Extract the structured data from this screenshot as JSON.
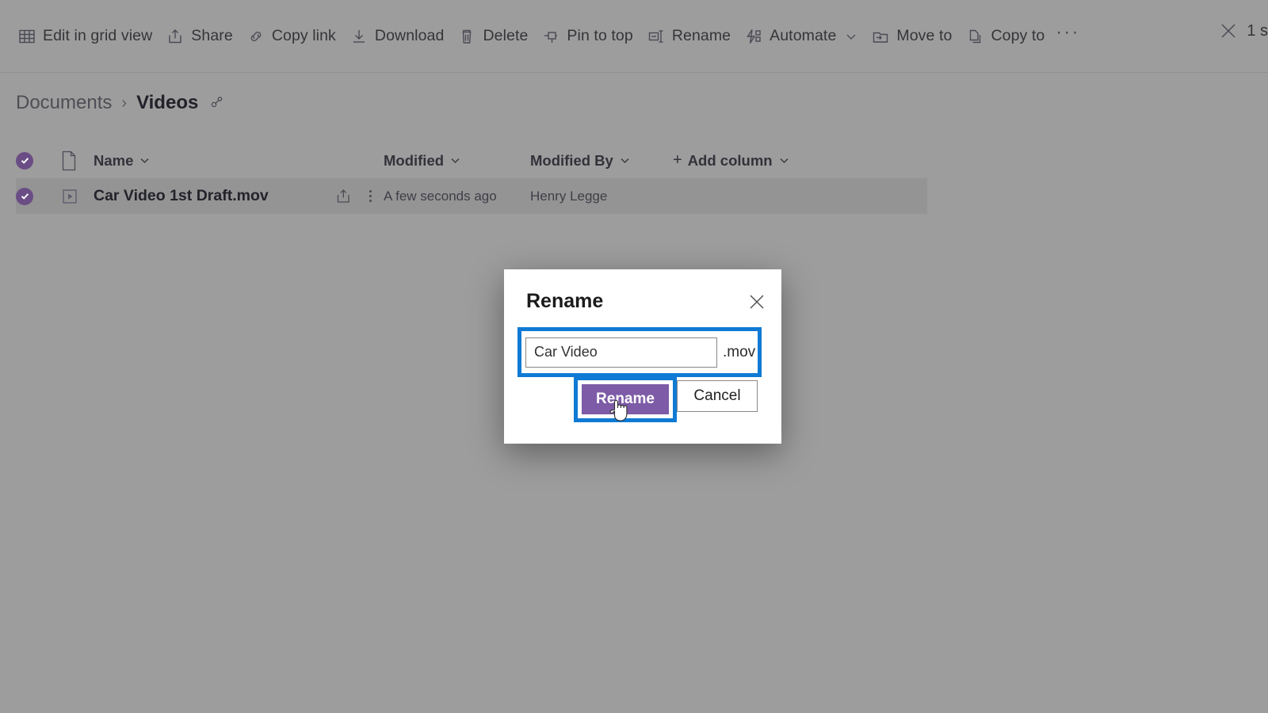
{
  "commandbar": {
    "items": [
      {
        "label": "Edit in grid view",
        "icon": "grid-icon",
        "has_chevron": false
      },
      {
        "label": "Share",
        "icon": "share-icon",
        "has_chevron": false
      },
      {
        "label": "Copy link",
        "icon": "link-icon",
        "has_chevron": false
      },
      {
        "label": "Download",
        "icon": "download-icon",
        "has_chevron": false
      },
      {
        "label": "Delete",
        "icon": "trash-icon",
        "has_chevron": false
      },
      {
        "label": "Pin to top",
        "icon": "pin-icon",
        "has_chevron": false
      },
      {
        "label": "Rename",
        "icon": "rename-icon",
        "has_chevron": false
      },
      {
        "label": "Automate",
        "icon": "automate-icon",
        "has_chevron": true
      },
      {
        "label": "Move to",
        "icon": "move-to-icon",
        "has_chevron": false
      },
      {
        "label": "Copy to",
        "icon": "copy-to-icon",
        "has_chevron": false
      }
    ],
    "overflow_label": "···",
    "selection": {
      "close_icon": "close-icon",
      "text": "1 s"
    }
  },
  "breadcrumb": {
    "root": "Documents",
    "separator": "›",
    "current": "Videos",
    "share_icon": "people-share-icon"
  },
  "list": {
    "columns": {
      "name": "Name",
      "modified": "Modified",
      "modified_by": "Modified By",
      "add_column": "Add column",
      "add_column_plus": "+"
    },
    "rows": [
      {
        "selected": true,
        "type_icon": "video-file-icon",
        "name": "Car Video 1st Draft.mov",
        "modified": "A few seconds ago",
        "modified_by": "Henry Legge",
        "share_icon": "share-icon",
        "more_icon": "more-vertical-icon"
      }
    ]
  },
  "dialog": {
    "title": "Rename",
    "close_icon": "close-icon",
    "input_value": "Car Video",
    "input_placeholder": "Car Video",
    "extension": ".mov",
    "primary_button": "Rename",
    "secondary_button": "Cancel"
  },
  "colors": {
    "accent_purple": "#7d5ba6",
    "selection_purple": "#6b4d85",
    "annotation_blue": "#0f7ad4",
    "overlay_grey": "#9d9d9d",
    "dialog_white": "#ffffff"
  },
  "cursor": {
    "type": "pointer-hand-cursor"
  }
}
